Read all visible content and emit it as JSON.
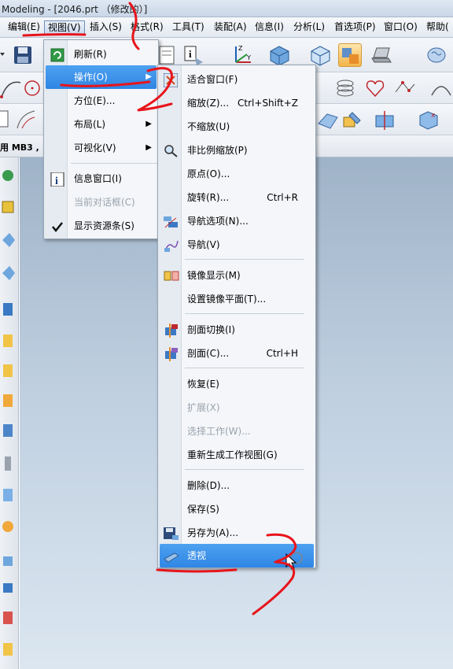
{
  "window": {
    "title": "Modeling - [2046.prt （修改的）]"
  },
  "menubar": {
    "items": [
      {
        "label": "编辑(E)"
      },
      {
        "label": "视图(V)"
      },
      {
        "label": "插入(S)"
      },
      {
        "label": "格式(R)"
      },
      {
        "label": "工具(T)"
      },
      {
        "label": "装配(A)"
      },
      {
        "label": "信息(I)"
      },
      {
        "label": "分析(L)"
      },
      {
        "label": "首选项(P)"
      },
      {
        "label": "窗口(O)"
      },
      {
        "label": "帮助("
      }
    ]
  },
  "status_strip": {
    "text": "用 MB3 ,"
  },
  "view_menu": {
    "items": [
      {
        "label": "刷新(R)",
        "icon": "refresh-icon"
      },
      {
        "label": "操作(O)",
        "submenu": true
      },
      {
        "label": "方位(E)..."
      },
      {
        "label": "布局(L)",
        "submenu": true
      },
      {
        "label": "可视化(V)",
        "submenu": true
      },
      {
        "label": "信息窗口(I)",
        "icon": "info-icon"
      },
      {
        "label": "当前对话框(C)",
        "disabled": true
      },
      {
        "label": "显示资源条(S)",
        "icon": "checkmark-icon"
      }
    ]
  },
  "operation_menu": {
    "items": [
      {
        "label": "适合窗口(F)",
        "icon": "fit-window-icon"
      },
      {
        "label": "缩放(Z)...",
        "shortcut": "Ctrl+Shift+Z"
      },
      {
        "label": "不缩放(U)"
      },
      {
        "label": "非比例缩放(P)",
        "icon": "magnifier-icon"
      },
      {
        "label": "原点(O)..."
      },
      {
        "label": "旋转(R)...",
        "shortcut": "Ctrl+R"
      },
      {
        "label": "导航选项(N)...",
        "icon": "navigation-options-icon"
      },
      {
        "label": "导航(V)",
        "icon": "navigation-icon"
      },
      {
        "label": "镜像显示(M)",
        "icon": "mirror-display-icon"
      },
      {
        "label": "设置镜像平面(T)..."
      },
      {
        "label": "剖面切换(I)",
        "icon": "section-toggle-icon"
      },
      {
        "label": "剖面(C)...",
        "shortcut": "Ctrl+H",
        "icon": "section-icon"
      },
      {
        "label": "恢复(E)"
      },
      {
        "label": "扩展(X)",
        "disabled": true
      },
      {
        "label": "选择工作(W)...",
        "disabled": true
      },
      {
        "label": "重新生成工作视图(G)"
      },
      {
        "label": "删除(D)..."
      },
      {
        "label": "保存(S)"
      },
      {
        "label": "另存为(A)...",
        "icon": "save-as-icon"
      },
      {
        "label": "透视",
        "icon": "perspective-icon"
      }
    ]
  },
  "annotations": {
    "color": "#e8141b"
  },
  "colors": {
    "highlight": "#3590e8",
    "menu_bg": "#f4f6f9"
  }
}
